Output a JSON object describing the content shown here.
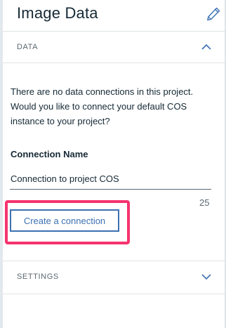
{
  "header": {
    "title": "Image Data",
    "edit_icon": "pencil-icon"
  },
  "data_section": {
    "label": "DATA",
    "state": "expanded",
    "toggle_icon": "chevron-up-icon",
    "message": "There are no data connections in this project. Would you like to connect your default COS instance to your project?",
    "connection_name_label": "Connection Name",
    "connection_name_value": "Connection to project COS",
    "char_remaining": "25",
    "create_button_label": "Create a connection"
  },
  "settings_section": {
    "label": "SETTINGS",
    "state": "collapsed",
    "toggle_icon": "chevron-down-icon"
  },
  "colors": {
    "accent": "#3d70b2",
    "highlight": "#f5336f",
    "text": "#152935",
    "muted": "#5a6872"
  }
}
